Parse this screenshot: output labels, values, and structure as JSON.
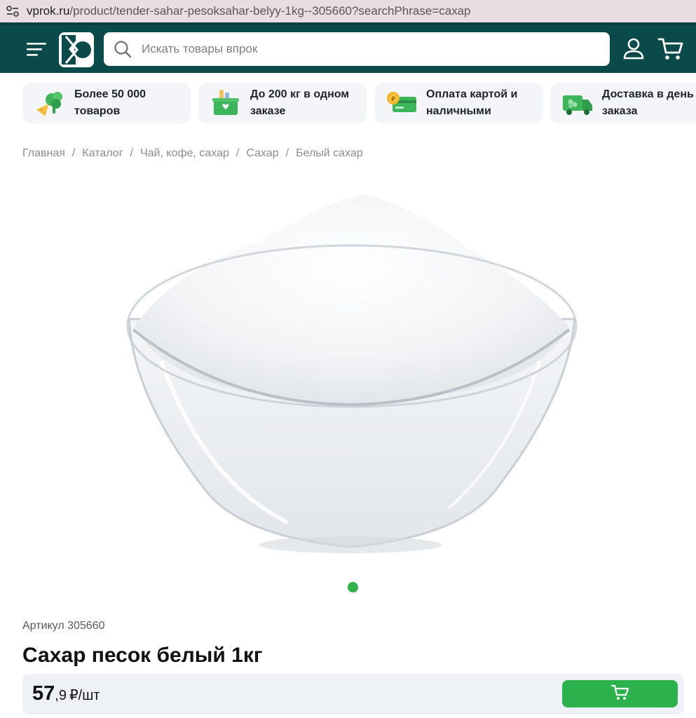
{
  "browser": {
    "url_host": "vprok.ru",
    "url_path": "/product/tender-sahar-pesoksahar-belyy-1kg--305660?searchPhrase=сахар"
  },
  "header": {
    "search_placeholder": "Искать товары впрок",
    "brand_color": "#0a4a4a"
  },
  "features": [
    {
      "icon": "vegetables-icon",
      "text": "Более 50 000\nтоваров"
    },
    {
      "icon": "grocery-box-icon",
      "text": "До 200 кг в одном\nзаказе"
    },
    {
      "icon": "payment-card-icon",
      "text": "Оплата картой и\nналичными"
    },
    {
      "icon": "delivery-truck-icon",
      "text": "Доставка в день\nзаказа"
    }
  ],
  "breadcrumb": [
    "Главная",
    "Каталог",
    "Чай, кофе, сахар",
    "Сахар",
    "Белый сахар"
  ],
  "product": {
    "sku_label": "Артикул 305660",
    "title": "Сахар песок белый 1кг",
    "price_int": "57",
    "price_frac": ",9",
    "price_unit": "₽/шт",
    "image_icon": "sugar-bowl-photo"
  },
  "colors": {
    "accent_green": "#2bb24c",
    "carousel_dot": "#31b34b"
  }
}
